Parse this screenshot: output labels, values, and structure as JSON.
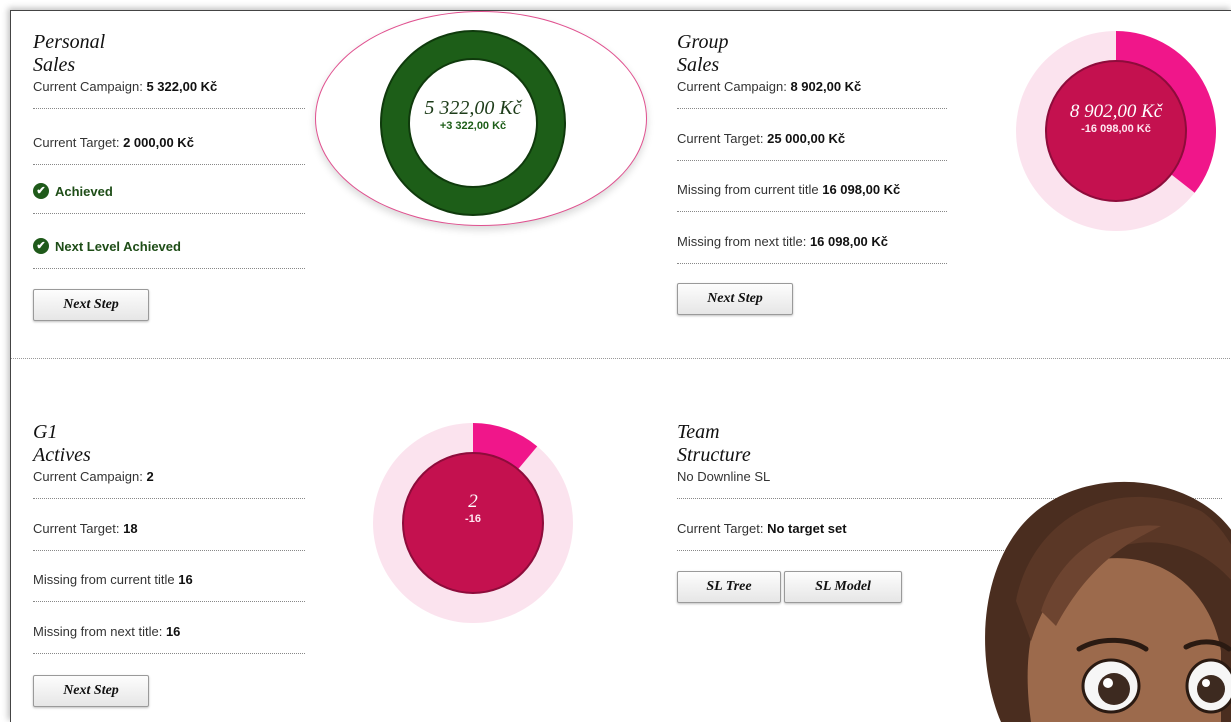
{
  "personal_sales": {
    "title": "Personal Sales",
    "current_campaign_label": "Current Campaign:",
    "current_campaign_value": "5 322,00 Kč",
    "current_target_label": "Current Target:",
    "current_target_value": "2 000,00 Kč",
    "achieved": "Achieved",
    "next_level_achieved": "Next Level Achieved",
    "next_step": "Next Step",
    "donut_main": "5 322,00 Kč",
    "donut_sub": "+3 322,00 Kč",
    "donut_color": "#1d5e18",
    "progress": 1.0
  },
  "group_sales": {
    "title": "Group Sales",
    "current_campaign_label": "Current Campaign:",
    "current_campaign_value": "8 902,00 Kč",
    "current_target_label": "Current Target:",
    "current_target_value": "25 000,00 Kč",
    "missing_current_label": "Missing from current title",
    "missing_current_value": "16 098,00 Kč",
    "missing_next_label": "Missing from next title:",
    "missing_next_value": "16 098,00 Kč",
    "next_step": "Next Step",
    "donut_main": "8 902,00 Kč",
    "donut_sub": "-16 098,00 Kč",
    "progress": 0.356
  },
  "g1_actives": {
    "title": "G1 Actives",
    "current_campaign_label": "Current Campaign:",
    "current_campaign_value": "2",
    "current_target_label": "Current Target:",
    "current_target_value": "18",
    "missing_current_label": "Missing from current title",
    "missing_current_value": "16",
    "missing_next_label": "Missing from next title:",
    "missing_next_value": "16",
    "next_step": "Next Step",
    "donut_main": "2",
    "donut_sub": "-16",
    "progress": 0.111
  },
  "team_structure": {
    "title": "Team Structure",
    "no_downline": "No Downline SL",
    "current_target_label": "Current Target:",
    "current_target_value": "No target set",
    "sl_tree": "SL Tree",
    "sl_model": "SL Model"
  },
  "colors": {
    "accent_pink": "#e8137f",
    "donut_magenta": "#c4114f",
    "donut_light": "#fbe3ee",
    "achieved_green": "#1d5e18"
  }
}
